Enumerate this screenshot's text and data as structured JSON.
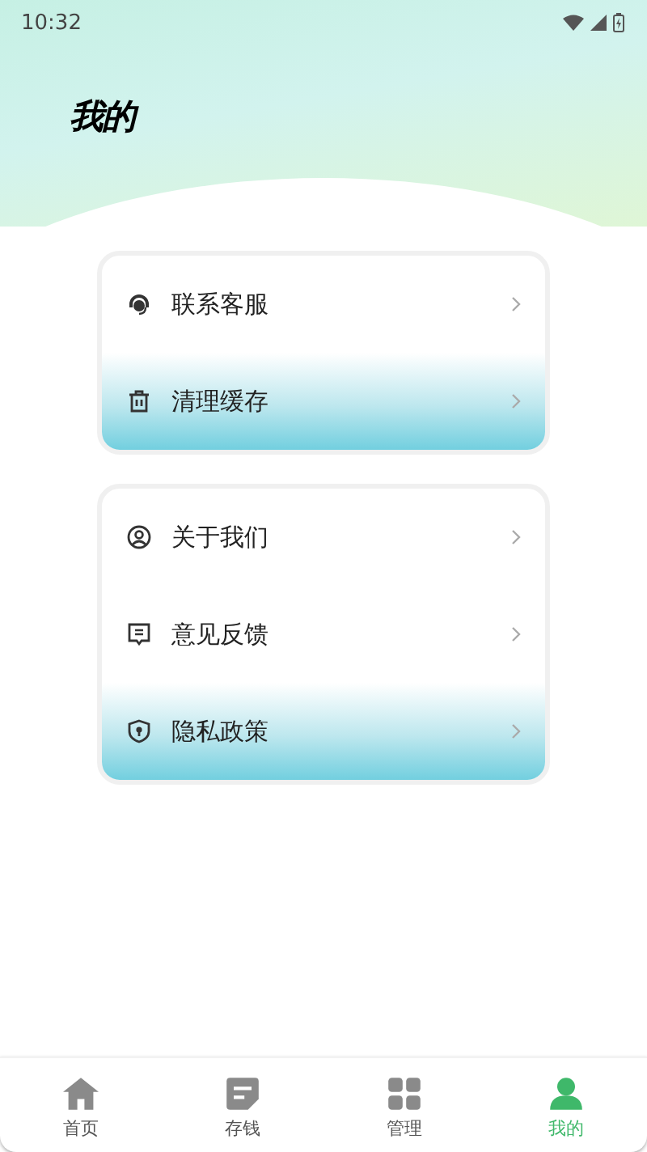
{
  "status_bar": {
    "time": "10:32"
  },
  "title": "我的",
  "groups": [
    {
      "items": [
        {
          "label": "联系客服",
          "highlighted": false
        },
        {
          "label": "清理缓存",
          "highlighted": true
        }
      ]
    },
    {
      "items": [
        {
          "label": "关于我们",
          "highlighted": false
        },
        {
          "label": "意见反馈",
          "highlighted": false
        },
        {
          "label": "隐私政策",
          "highlighted": true
        }
      ]
    }
  ],
  "tabs": [
    {
      "label": "首页",
      "selected": false
    },
    {
      "label": "存钱",
      "selected": false
    },
    {
      "label": "管理",
      "selected": false
    },
    {
      "label": "我的",
      "selected": true
    }
  ]
}
